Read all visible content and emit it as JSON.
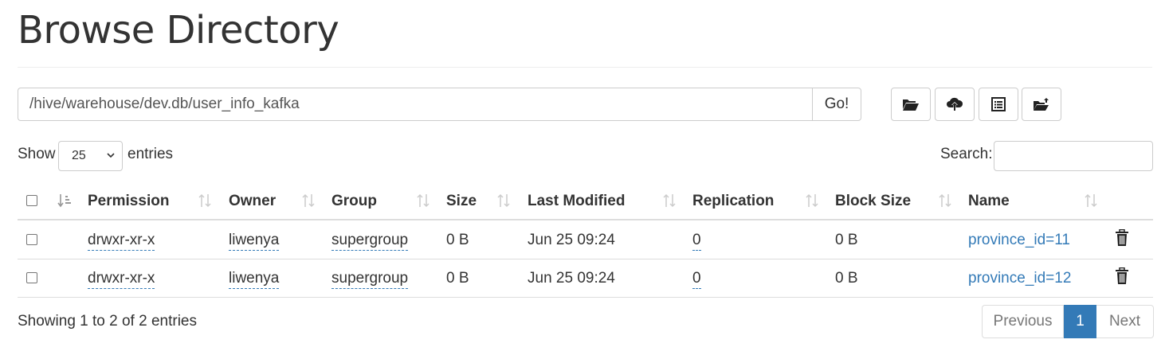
{
  "page": {
    "title": "Browse Directory"
  },
  "path_bar": {
    "value": "/hive/warehouse/dev.db/user_info_kafka",
    "go_label": "Go!"
  },
  "toolbar": {
    "icons": [
      "folder-open-icon",
      "cloud-upload-icon",
      "list-alt-icon",
      "folder-upload-icon"
    ]
  },
  "length_menu": {
    "show_label": "Show",
    "selected": "25",
    "entries_label": "entries"
  },
  "search": {
    "label": "Search:",
    "value": ""
  },
  "table": {
    "columns": [
      "Permission",
      "Owner",
      "Group",
      "Size",
      "Last Modified",
      "Replication",
      "Block Size",
      "Name"
    ],
    "rows": [
      {
        "permission": "drwxr-xr-x",
        "owner": "liwenya",
        "group": "supergroup",
        "size": "0 B",
        "last_modified": "Jun 25 09:24",
        "replication": "0",
        "block_size": "0 B",
        "name": "province_id=11"
      },
      {
        "permission": "drwxr-xr-x",
        "owner": "liwenya",
        "group": "supergroup",
        "size": "0 B",
        "last_modified": "Jun 25 09:24",
        "replication": "0",
        "block_size": "0 B",
        "name": "province_id=12"
      }
    ]
  },
  "footer": {
    "info": "Showing 1 to 2 of 2 entries",
    "pagination": {
      "previous": "Previous",
      "current": "1",
      "next": "Next"
    }
  },
  "colors": {
    "link": "#337ab7",
    "active_page": "#337ab7",
    "border": "#dddddd"
  }
}
